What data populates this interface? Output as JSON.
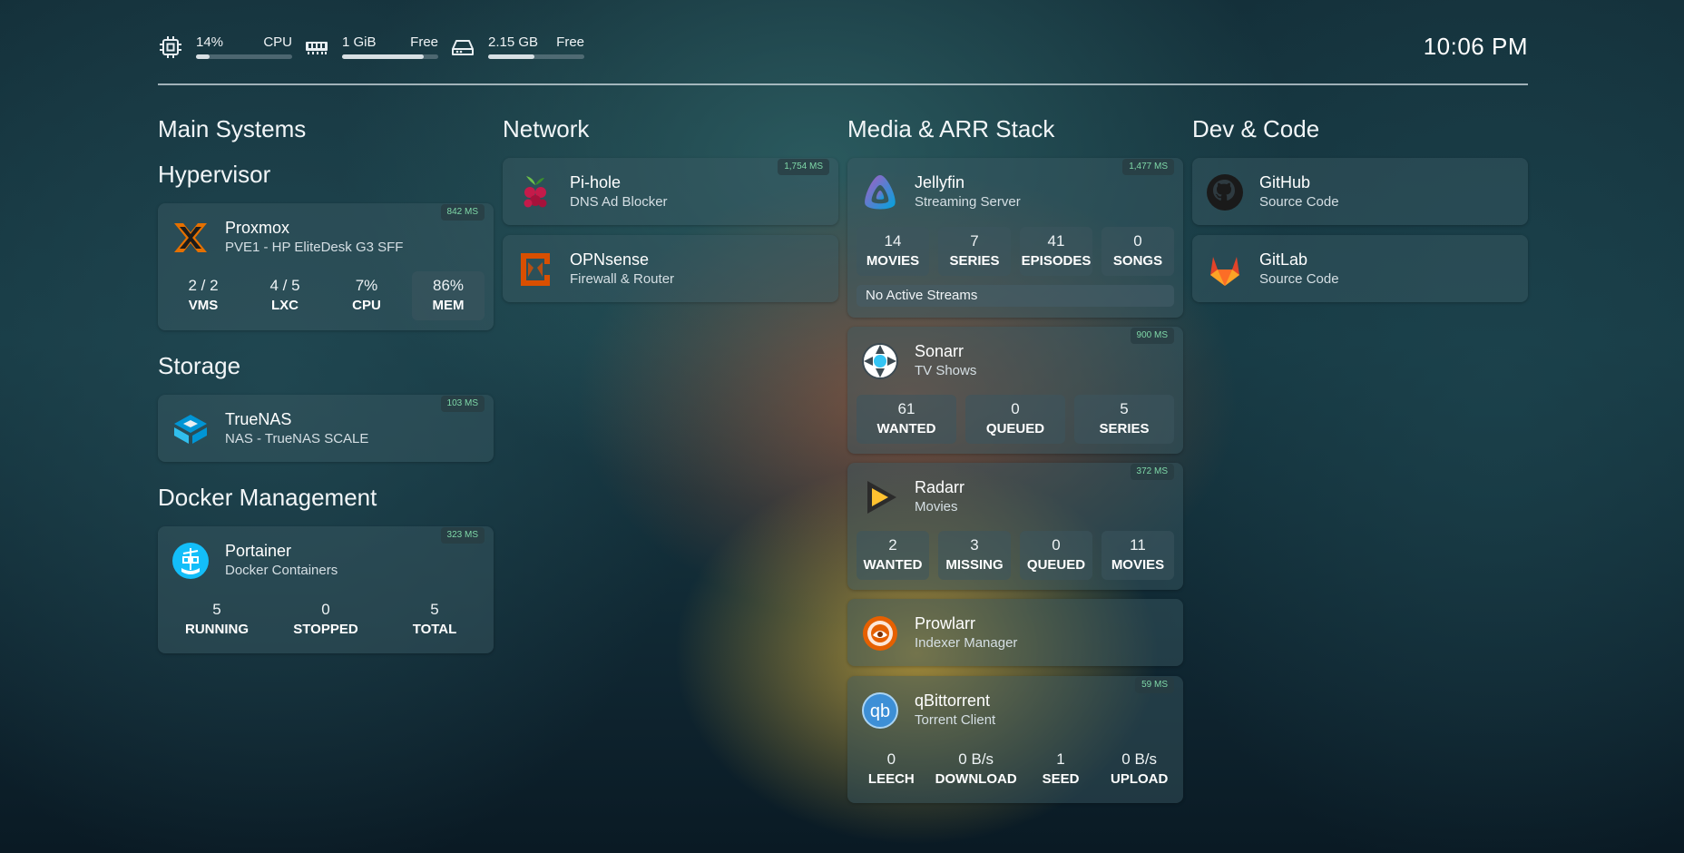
{
  "resources": {
    "cpu": {
      "value": "14%",
      "label": "CPU",
      "percent": 14,
      "icon": "cpu-icon"
    },
    "memory": {
      "value": "1 GiB",
      "label": "Free",
      "percent": 85,
      "icon": "ram-icon"
    },
    "disk": {
      "value": "2.15 GB",
      "label": "Free",
      "percent": 48,
      "icon": "hard-drive-icon"
    }
  },
  "clock": "10:06 PM",
  "columns": {
    "main": {
      "title": "Main Systems",
      "hypervisor": {
        "title": "Hypervisor",
        "proxmox": {
          "name": "Proxmox",
          "desc": "PVE1 - HP EliteDesk G3 SFF",
          "ping": "842 MS",
          "stats": [
            {
              "n": "2 / 2",
              "l": "VMS"
            },
            {
              "n": "4 / 5",
              "l": "LXC"
            },
            {
              "n": "7%",
              "l": "CPU"
            },
            {
              "n": "86%",
              "l": "MEM"
            }
          ]
        }
      },
      "storage": {
        "title": "Storage",
        "truenas": {
          "name": "TrueNAS",
          "desc": "NAS - TrueNAS SCALE",
          "ping": "103 MS"
        }
      },
      "docker": {
        "title": "Docker Management",
        "portainer": {
          "name": "Portainer",
          "desc": "Docker Containers",
          "ping": "323 MS",
          "stats": [
            {
              "n": "5",
              "l": "RUNNING"
            },
            {
              "n": "0",
              "l": "STOPPED"
            },
            {
              "n": "5",
              "l": "TOTAL"
            }
          ]
        }
      }
    },
    "network": {
      "title": "Network",
      "pihole": {
        "name": "Pi-hole",
        "desc": "DNS Ad Blocker",
        "ping": "1,754 MS"
      },
      "opnsense": {
        "name": "OPNsense",
        "desc": "Firewall & Router"
      }
    },
    "media": {
      "title": "Media & ARR Stack",
      "jellyfin": {
        "name": "Jellyfin",
        "desc": "Streaming Server",
        "ping": "1,477 MS",
        "stats": [
          {
            "n": "14",
            "l": "MOVIES"
          },
          {
            "n": "7",
            "l": "SERIES"
          },
          {
            "n": "41",
            "l": "EPISODES"
          },
          {
            "n": "0",
            "l": "SONGS"
          }
        ],
        "notice": "No Active Streams"
      },
      "sonarr": {
        "name": "Sonarr",
        "desc": "TV Shows",
        "ping": "900 MS",
        "stats": [
          {
            "n": "61",
            "l": "WANTED"
          },
          {
            "n": "0",
            "l": "QUEUED"
          },
          {
            "n": "5",
            "l": "SERIES"
          }
        ]
      },
      "radarr": {
        "name": "Radarr",
        "desc": "Movies",
        "ping": "372 MS",
        "stats": [
          {
            "n": "2",
            "l": "WANTED"
          },
          {
            "n": "3",
            "l": "MISSING"
          },
          {
            "n": "0",
            "l": "QUEUED"
          },
          {
            "n": "11",
            "l": "MOVIES"
          }
        ]
      },
      "prowlarr": {
        "name": "Prowlarr",
        "desc": "Indexer Manager"
      },
      "qbittorrent": {
        "name": "qBittorrent",
        "desc": "Torrent Client",
        "ping": "59 MS",
        "logo_text": "qb",
        "stats": [
          {
            "n": "0",
            "l": "LEECH"
          },
          {
            "n": "0 B/s",
            "l": "DOWNLOAD"
          },
          {
            "n": "1",
            "l": "SEED"
          },
          {
            "n": "0 B/s",
            "l": "UPLOAD"
          }
        ]
      }
    },
    "dev": {
      "title": "Dev & Code",
      "github": {
        "name": "GitHub",
        "desc": "Source Code"
      },
      "gitlab": {
        "name": "GitLab",
        "desc": "Source Code"
      }
    }
  }
}
